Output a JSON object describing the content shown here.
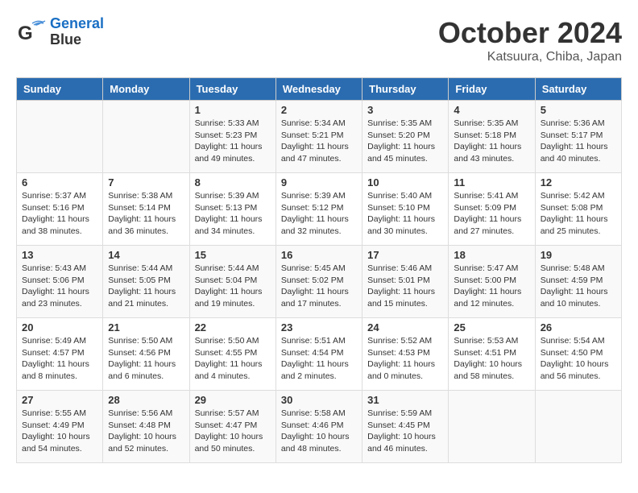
{
  "header": {
    "logo_line1": "General",
    "logo_line2": "Blue",
    "month": "October 2024",
    "location": "Katsuura, Chiba, Japan"
  },
  "days_of_week": [
    "Sunday",
    "Monday",
    "Tuesday",
    "Wednesday",
    "Thursday",
    "Friday",
    "Saturday"
  ],
  "weeks": [
    [
      {
        "day": "",
        "content": ""
      },
      {
        "day": "",
        "content": ""
      },
      {
        "day": "1",
        "content": "Sunrise: 5:33 AM\nSunset: 5:23 PM\nDaylight: 11 hours and 49 minutes."
      },
      {
        "day": "2",
        "content": "Sunrise: 5:34 AM\nSunset: 5:21 PM\nDaylight: 11 hours and 47 minutes."
      },
      {
        "day": "3",
        "content": "Sunrise: 5:35 AM\nSunset: 5:20 PM\nDaylight: 11 hours and 45 minutes."
      },
      {
        "day": "4",
        "content": "Sunrise: 5:35 AM\nSunset: 5:18 PM\nDaylight: 11 hours and 43 minutes."
      },
      {
        "day": "5",
        "content": "Sunrise: 5:36 AM\nSunset: 5:17 PM\nDaylight: 11 hours and 40 minutes."
      }
    ],
    [
      {
        "day": "6",
        "content": "Sunrise: 5:37 AM\nSunset: 5:16 PM\nDaylight: 11 hours and 38 minutes."
      },
      {
        "day": "7",
        "content": "Sunrise: 5:38 AM\nSunset: 5:14 PM\nDaylight: 11 hours and 36 minutes."
      },
      {
        "day": "8",
        "content": "Sunrise: 5:39 AM\nSunset: 5:13 PM\nDaylight: 11 hours and 34 minutes."
      },
      {
        "day": "9",
        "content": "Sunrise: 5:39 AM\nSunset: 5:12 PM\nDaylight: 11 hours and 32 minutes."
      },
      {
        "day": "10",
        "content": "Sunrise: 5:40 AM\nSunset: 5:10 PM\nDaylight: 11 hours and 30 minutes."
      },
      {
        "day": "11",
        "content": "Sunrise: 5:41 AM\nSunset: 5:09 PM\nDaylight: 11 hours and 27 minutes."
      },
      {
        "day": "12",
        "content": "Sunrise: 5:42 AM\nSunset: 5:08 PM\nDaylight: 11 hours and 25 minutes."
      }
    ],
    [
      {
        "day": "13",
        "content": "Sunrise: 5:43 AM\nSunset: 5:06 PM\nDaylight: 11 hours and 23 minutes."
      },
      {
        "day": "14",
        "content": "Sunrise: 5:44 AM\nSunset: 5:05 PM\nDaylight: 11 hours and 21 minutes."
      },
      {
        "day": "15",
        "content": "Sunrise: 5:44 AM\nSunset: 5:04 PM\nDaylight: 11 hours and 19 minutes."
      },
      {
        "day": "16",
        "content": "Sunrise: 5:45 AM\nSunset: 5:02 PM\nDaylight: 11 hours and 17 minutes."
      },
      {
        "day": "17",
        "content": "Sunrise: 5:46 AM\nSunset: 5:01 PM\nDaylight: 11 hours and 15 minutes."
      },
      {
        "day": "18",
        "content": "Sunrise: 5:47 AM\nSunset: 5:00 PM\nDaylight: 11 hours and 12 minutes."
      },
      {
        "day": "19",
        "content": "Sunrise: 5:48 AM\nSunset: 4:59 PM\nDaylight: 11 hours and 10 minutes."
      }
    ],
    [
      {
        "day": "20",
        "content": "Sunrise: 5:49 AM\nSunset: 4:57 PM\nDaylight: 11 hours and 8 minutes."
      },
      {
        "day": "21",
        "content": "Sunrise: 5:50 AM\nSunset: 4:56 PM\nDaylight: 11 hours and 6 minutes."
      },
      {
        "day": "22",
        "content": "Sunrise: 5:50 AM\nSunset: 4:55 PM\nDaylight: 11 hours and 4 minutes."
      },
      {
        "day": "23",
        "content": "Sunrise: 5:51 AM\nSunset: 4:54 PM\nDaylight: 11 hours and 2 minutes."
      },
      {
        "day": "24",
        "content": "Sunrise: 5:52 AM\nSunset: 4:53 PM\nDaylight: 11 hours and 0 minutes."
      },
      {
        "day": "25",
        "content": "Sunrise: 5:53 AM\nSunset: 4:51 PM\nDaylight: 10 hours and 58 minutes."
      },
      {
        "day": "26",
        "content": "Sunrise: 5:54 AM\nSunset: 4:50 PM\nDaylight: 10 hours and 56 minutes."
      }
    ],
    [
      {
        "day": "27",
        "content": "Sunrise: 5:55 AM\nSunset: 4:49 PM\nDaylight: 10 hours and 54 minutes."
      },
      {
        "day": "28",
        "content": "Sunrise: 5:56 AM\nSunset: 4:48 PM\nDaylight: 10 hours and 52 minutes."
      },
      {
        "day": "29",
        "content": "Sunrise: 5:57 AM\nSunset: 4:47 PM\nDaylight: 10 hours and 50 minutes."
      },
      {
        "day": "30",
        "content": "Sunrise: 5:58 AM\nSunset: 4:46 PM\nDaylight: 10 hours and 48 minutes."
      },
      {
        "day": "31",
        "content": "Sunrise: 5:59 AM\nSunset: 4:45 PM\nDaylight: 10 hours and 46 minutes."
      },
      {
        "day": "",
        "content": ""
      },
      {
        "day": "",
        "content": ""
      }
    ]
  ]
}
